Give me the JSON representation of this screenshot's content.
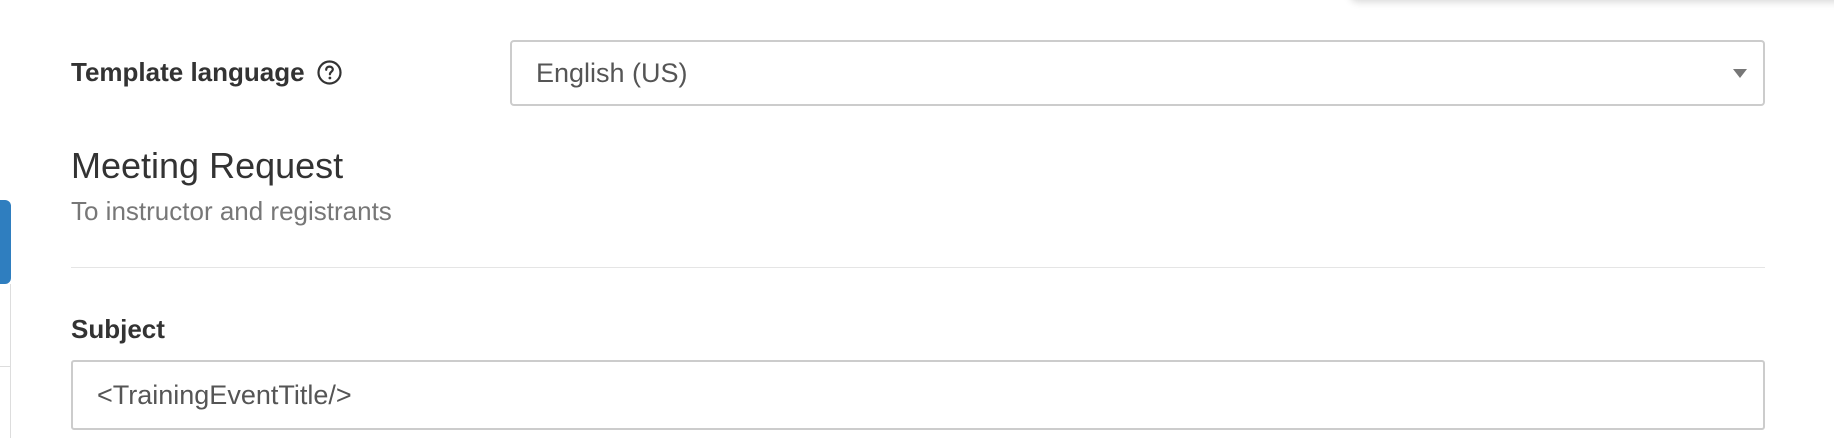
{
  "template_language": {
    "label": "Template language",
    "help_icon": "question-circle-icon",
    "selected_value": "English (US)"
  },
  "section": {
    "title": "Meeting Request",
    "subtitle": "To instructor and registrants"
  },
  "subject": {
    "label": "Subject",
    "value": "<TrainingEventTitle/>"
  },
  "colors": {
    "accent_tab": "#2f7ebf",
    "border": "#cccccc",
    "text": "#333333",
    "muted_text": "#777777"
  }
}
